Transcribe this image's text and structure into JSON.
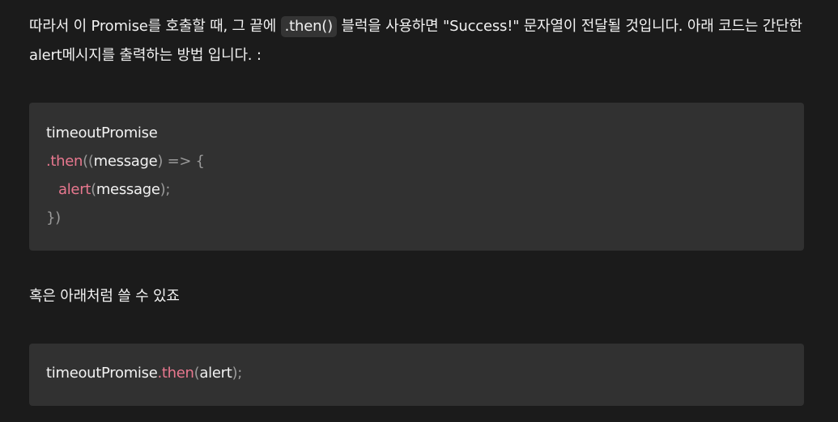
{
  "paragraph_1": {
    "part_1": "따라서 이 Promise를 호출할 때, 그 끝에 ",
    "inline_code": ".then()",
    "part_2": " 블럭을 사용하면 \"Success!\" 문자열이 전달될 것입니다. 아래 코드는 간단한 alert메시지를 출력하는 방법 입니다. :"
  },
  "code_block_1": {
    "line_1": {
      "ident": "timeoutPromise"
    },
    "line_2": {
      "method": ".then",
      "punct_open": "((",
      "param": "message",
      "punct_arrow_open": ") => {"
    },
    "line_3": {
      "method": "alert",
      "punct_open": "(",
      "arg": "message",
      "punct_close": ");"
    },
    "line_4": {
      "punct": "})"
    }
  },
  "paragraph_2": {
    "text": "혹은 아래처럼 쓸 수 있죠"
  },
  "code_block_2": {
    "line_1": {
      "ident": "timeoutPromise",
      "method": ".then",
      "punct_open": "(",
      "arg": "alert",
      "punct_close": ");"
    }
  },
  "colors": {
    "background": "#1b1b1b",
    "code_background": "#313131",
    "inline_code_background": "#343434",
    "text": "#f2f2f2",
    "method": "#e8788f",
    "punctuation": "#9a9a9a"
  }
}
